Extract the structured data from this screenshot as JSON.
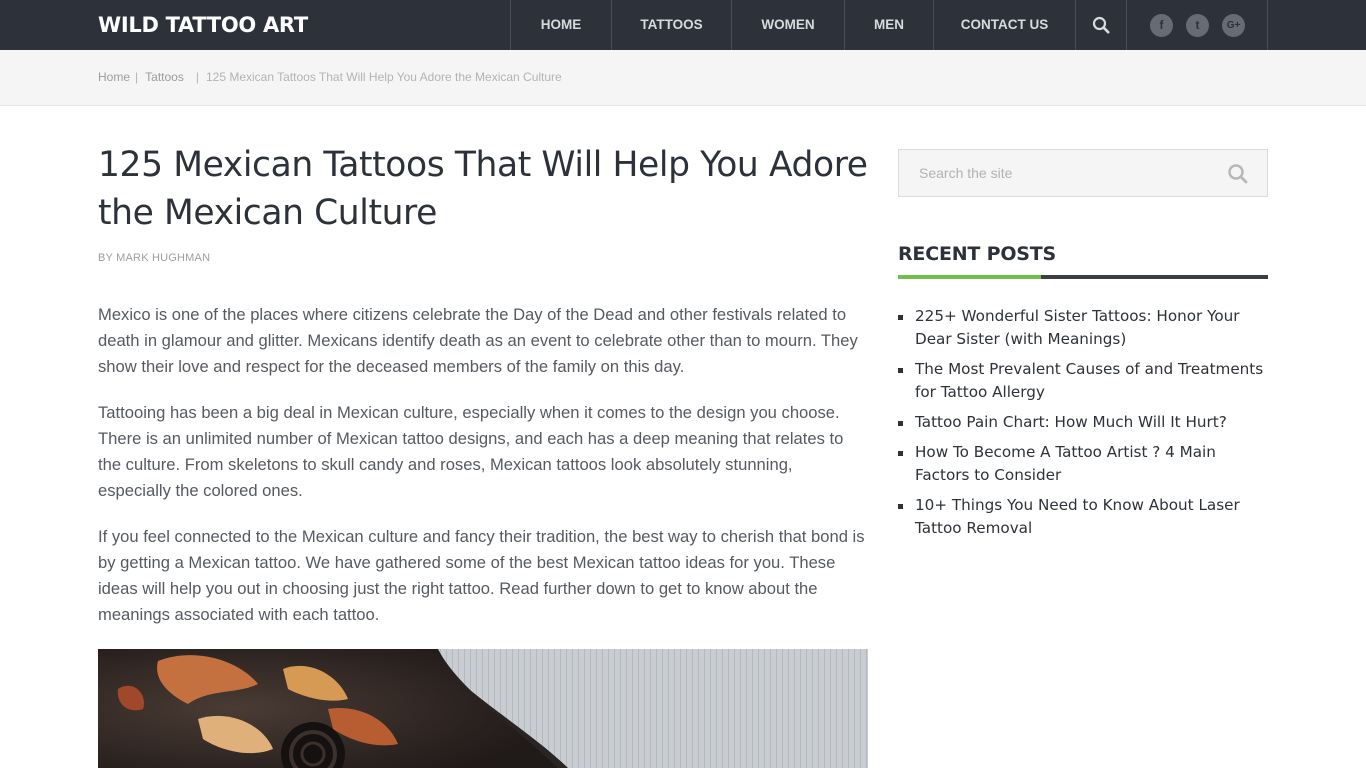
{
  "site": {
    "logo": "WILD TATTOO ART"
  },
  "nav": {
    "items": [
      {
        "label": "HOME"
      },
      {
        "label": "TATTOOS"
      },
      {
        "label": "WOMEN"
      },
      {
        "label": "MEN"
      },
      {
        "label": "CONTACT US"
      }
    ],
    "search_icon": "search-icon",
    "social": [
      {
        "icon": "facebook-icon",
        "glyph": "f"
      },
      {
        "icon": "twitter-icon",
        "glyph": "t"
      },
      {
        "icon": "google-plus-icon",
        "glyph": "G+"
      }
    ]
  },
  "breadcrumb": {
    "home": "Home",
    "category": "Tattoos",
    "current": "125 Mexican Tattoos That Will Help You Adore the Mexican Culture",
    "separator": "|"
  },
  "article": {
    "title": "125 Mexican Tattoos That Will Help You Adore the Mexican Culture",
    "by": "BY",
    "author": "MARK HUGHMAN",
    "paragraphs": [
      "Mexico is one of the places where citizens celebrate the Day of the Dead and other festivals related to death in glamour and glitter. Mexicans identify death as an event to celebrate other than to mourn. They show their love and respect for the deceased members of the family on this day.",
      "Tattooing has been a big deal in Mexican culture, especially when it comes to the design you choose. There is an unlimited number of Mexican tattoo designs, and each has a deep meaning that relates to the culture. From skeletons to skull candy and roses, Mexican tattoos look absolutely stunning, especially the colored ones.",
      "If you feel connected to the Mexican culture and fancy their tradition, the best way to cherish that bond is by getting a Mexican tattoo. We have gathered some of the best Mexican tattoo ideas for you. These ideas will help you out in choosing just the right tattoo. Read further down to get to know about the meanings associated with each tattoo."
    ]
  },
  "sidebar": {
    "search": {
      "placeholder": "Search the site"
    },
    "recent_title": "RECENT POSTS",
    "recent_posts": [
      "225+ Wonderful Sister Tattoos: Honor Your Dear Sister (with Meanings)",
      "The Most Prevalent Causes of and Treatments for Tattoo Allergy",
      "Tattoo Pain Chart: How Much Will It Hurt?",
      "How To Become A Tattoo Artist ? 4 Main Factors to Consider",
      "10+ Things You Need to Know About Laser Tattoo Removal"
    ]
  },
  "colors": {
    "topbar": "#2d323a",
    "accent_green": "#6fbf4d",
    "breadcrumb_bg": "#f5f5f5"
  }
}
